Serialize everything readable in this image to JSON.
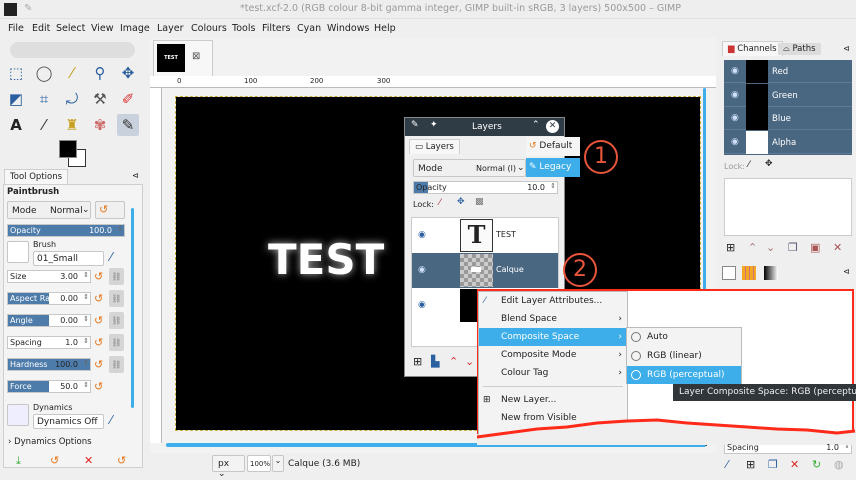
{
  "window": {
    "title": "*test.xcf-2.0 (RGB colour 8-bit gamma integer, GIMP built-in sRGB, 3 layers) 500x500 – GIMP"
  },
  "menu": [
    "File",
    "Edit",
    "Select",
    "View",
    "Image",
    "Layer",
    "Colours",
    "Tools",
    "Filters",
    "Cyan",
    "Windows",
    "Help"
  ],
  "image_tab": {
    "thumb_text": "TEST"
  },
  "ruler": {
    "ticks": [
      "0",
      "100",
      "200",
      "300"
    ]
  },
  "canvas": {
    "text": "TEST"
  },
  "tool_options": {
    "tab": "Tool Options",
    "tool": "Paintbrush",
    "mode_label": "Mode",
    "mode_value": "Normal",
    "opacity": {
      "label": "Opacity",
      "value": "100.0",
      "fraction": 1.0
    },
    "brush_label": "Brush",
    "brush_value": "01_Small",
    "sliders": [
      {
        "label": "Size",
        "value": "3.00",
        "fraction": 0.0
      },
      {
        "label": "Aspect Ratio",
        "value": "0.00",
        "fraction": 0.5
      },
      {
        "label": "Angle",
        "value": "0.00",
        "fraction": 0.5
      },
      {
        "label": "Spacing",
        "value": "1.0",
        "fraction": 0.0
      },
      {
        "label": "Hardness",
        "value": "100.0",
        "fraction": 1.0
      },
      {
        "label": "Force",
        "value": "50.0",
        "fraction": 0.5
      }
    ],
    "dynamics_label": "Dynamics",
    "dynamics_value": "Dynamics Off",
    "dynamics_options": "Dynamics Options"
  },
  "layers_dialog": {
    "title": "Layers",
    "tab": "Layers",
    "mode_label": "Mode",
    "mode_value": "Normal (l)",
    "default_btn": "Default",
    "legacy_btn": "Legacy",
    "opacity_label": "Opacity",
    "opacity_value": "10.0",
    "opacity_fraction": 0.1,
    "lock_label": "Lock:",
    "layers": [
      {
        "name": "TEST",
        "selected": false
      },
      {
        "name": "Calque",
        "selected": true
      },
      {
        "name": "",
        "selected": false
      }
    ]
  },
  "annotations": [
    "1",
    "2"
  ],
  "context_menu": {
    "items": [
      {
        "label": "Edit Layer Attributes...",
        "submenu": false
      },
      {
        "label": "Blend Space",
        "submenu": true
      },
      {
        "label": "Composite Space",
        "submenu": true,
        "highlighted": true
      },
      {
        "label": "Composite Mode",
        "submenu": true
      },
      {
        "label": "Colour Tag",
        "submenu": true
      },
      {
        "label": "New Layer...",
        "submenu": false
      },
      {
        "label": "New from Visible",
        "submenu": false
      }
    ],
    "submenu": [
      {
        "label": "Auto",
        "selected": false
      },
      {
        "label": "RGB (linear)",
        "selected": false
      },
      {
        "label": "RGB (perceptual)",
        "selected": true
      }
    ],
    "tooltip": "Layer Composite Space: RGB (perceptua"
  },
  "right_dock": {
    "tabs": [
      "Channels",
      "Paths"
    ],
    "channels": [
      "Red",
      "Green",
      "Blue",
      "Alpha"
    ],
    "lock_label": "Lock:",
    "spacing_label": "Spacing",
    "spacing_value": "1.0"
  },
  "status": {
    "unit": "px",
    "zoom": "100%",
    "info": "Calque (3.6 MB)"
  },
  "colors": {
    "selection": "#4a6782",
    "highlight": "#3daee9",
    "annotation": "#e8553a",
    "box": "#ff2a1a"
  }
}
